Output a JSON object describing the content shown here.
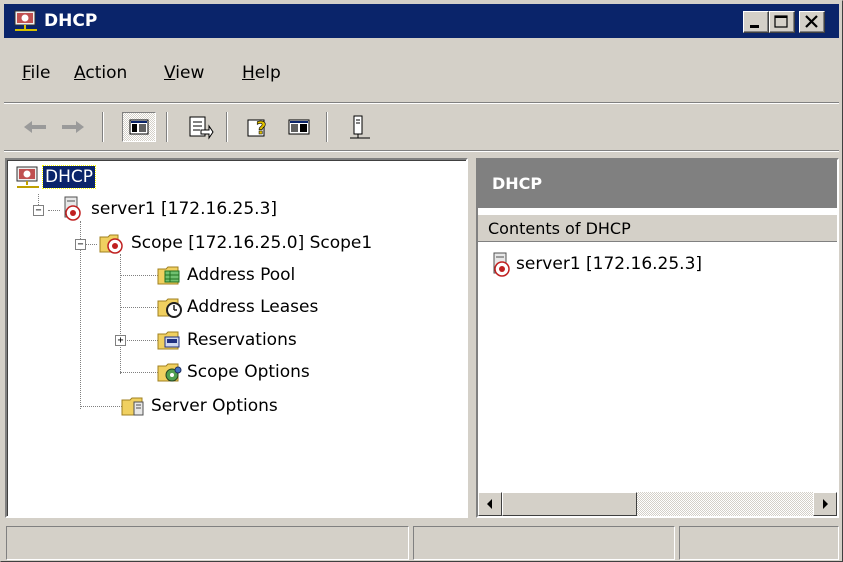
{
  "window": {
    "title": "DHCP"
  },
  "menu": {
    "items": [
      {
        "label": "File",
        "accel": "F",
        "rest": "ile"
      },
      {
        "label": "Action",
        "accel": "A",
        "rest": "ction"
      },
      {
        "label": "View",
        "accel": "V",
        "rest": "iew"
      },
      {
        "label": "Help",
        "accel": "H",
        "rest": "elp"
      }
    ]
  },
  "toolbar": {
    "buttons": [
      {
        "icon": "back-arrow-icon"
      },
      {
        "icon": "forward-arrow-icon"
      },
      {
        "icon": "show-hide-tree-icon",
        "pressed": true
      },
      {
        "icon": "export-list-icon"
      },
      {
        "icon": "help-icon"
      },
      {
        "icon": "show-hide-action-pane-icon"
      },
      {
        "icon": "server-status-icon"
      }
    ]
  },
  "tree": {
    "root": {
      "label": "DHCP",
      "selected": true,
      "icon": "dhcp-console-icon"
    },
    "server": {
      "label": "server1 [172.16.25.3]",
      "icon": "dhcp-server-icon"
    },
    "scope": {
      "label": "Scope [172.16.25.0] Scope1",
      "icon": "scope-folder-icon"
    },
    "scope_children": [
      {
        "label": "Address Pool",
        "icon": "address-pool-icon"
      },
      {
        "label": "Address Leases",
        "icon": "address-leases-icon"
      },
      {
        "label": "Reservations",
        "icon": "reservations-icon"
      },
      {
        "label": "Scope Options",
        "icon": "scope-options-icon"
      }
    ],
    "server_options": {
      "label": "Server Options",
      "icon": "server-options-icon"
    }
  },
  "right_pane": {
    "header": "DHCP",
    "column_header": "Contents of DHCP",
    "items": [
      {
        "label": "server1 [172.16.25.3]",
        "icon": "dhcp-server-icon"
      }
    ]
  },
  "status_bar": {
    "panes": [
      "",
      "",
      ""
    ]
  },
  "colors": {
    "titlebar": "#0a246a",
    "face": "#d4d0c8",
    "pane_header": "#808080",
    "selection": "#0a246a"
  }
}
